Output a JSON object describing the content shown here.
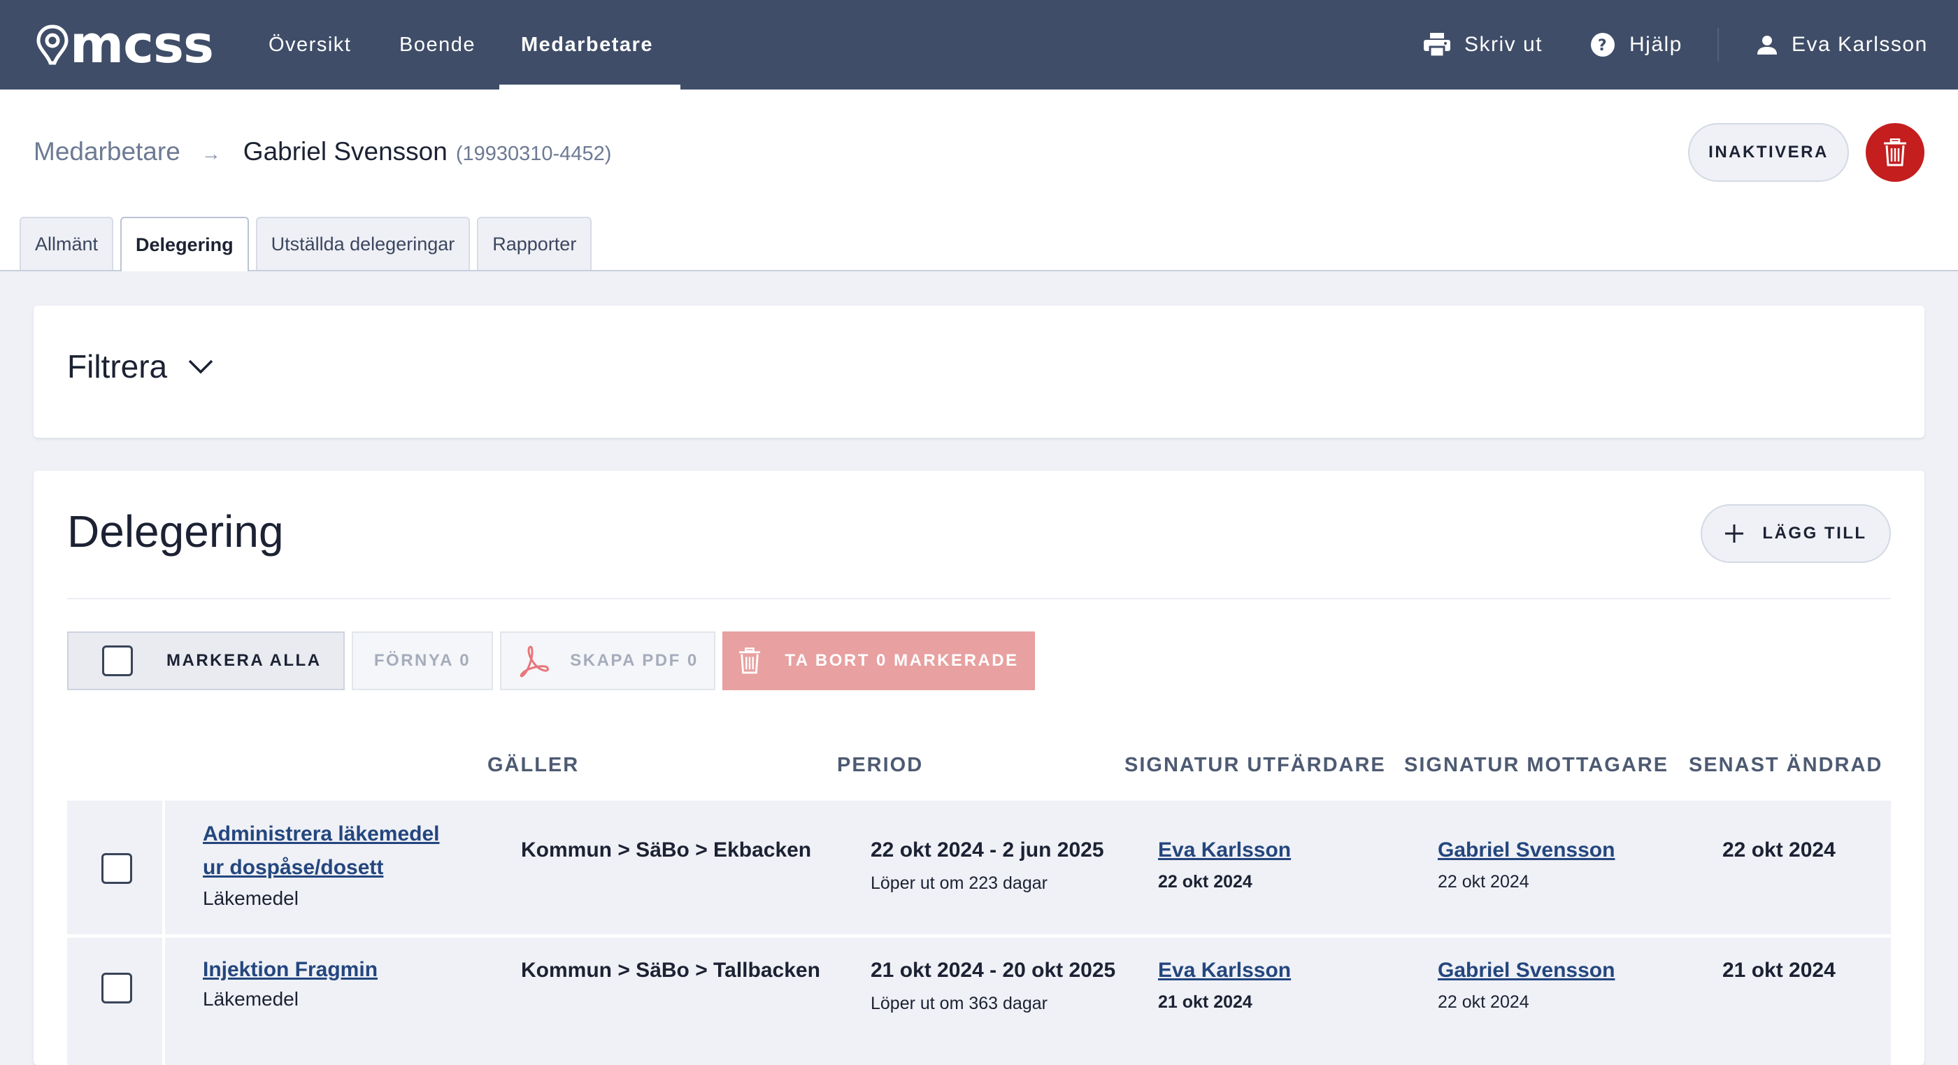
{
  "app": {
    "logo_text": "mcss",
    "nav": [
      {
        "label": "Översikt"
      },
      {
        "label": "Boende"
      },
      {
        "label": "Medarbetare",
        "active": true
      }
    ],
    "print_label": "Skriv ut",
    "help_label": "Hjälp",
    "user_name": "Eva Karlsson"
  },
  "breadcrumb": {
    "parent": "Medarbetare",
    "current": "Gabriel Svensson",
    "id": "(19930310-4452)"
  },
  "header": {
    "inaktivera_label": "INAKTIVERA"
  },
  "tabs": [
    {
      "label": "Allmänt"
    },
    {
      "label": "Delegering",
      "active": true
    },
    {
      "label": "Utställda delegeringar"
    },
    {
      "label": "Rapporter"
    }
  ],
  "filter": {
    "title": "Filtrera"
  },
  "delegering": {
    "title": "Delegering",
    "add_label": "LÄGG TILL",
    "actions": {
      "markera_alla": "MARKERA ALLA",
      "fornya": "FÖRNYA 0",
      "skapa_pdf": "SKAPA PDF 0",
      "ta_bort": "TA BORT 0 MARKERADE"
    },
    "columns": [
      "GÄLLER",
      "PERIOD",
      "SIGNATUR UTFÄRDARE",
      "SIGNATUR MOTTAGARE",
      "SENAST ÄNDRAD"
    ],
    "rows": [
      {
        "title_line1": "Administrera läkemedel",
        "title_line2": "ur dospåse/dosett",
        "category": "Läkemedel",
        "galler": "Kommun > SäBo > Ekbacken",
        "period": "22 okt 2024 - 2 jun 2025",
        "period_note": "Löper ut om 223 dagar",
        "utfardare": "Eva Karlsson",
        "utfardare_date": "22 okt 2024",
        "mottagare": "Gabriel Svensson",
        "mottagare_date": "22 okt 2024",
        "senast_andrad": "22 okt 2024"
      },
      {
        "title_line1": "Injektion Fragmin",
        "category": "Läkemedel",
        "galler": "Kommun > SäBo > Tallbacken",
        "period": "21 okt 2024 - 20 okt 2025",
        "period_note": "Löper ut om 363 dagar",
        "utfardare": "Eva Karlsson",
        "utfardare_date": "21 okt 2024",
        "mottagare": "Gabriel Svensson",
        "mottagare_date": "22 okt 2024",
        "senast_andrad": "21 okt 2024"
      }
    ]
  },
  "colors": {
    "nav_bg": "#3f4d68",
    "danger": "#c41e1e",
    "danger_soft": "#e8a0a0",
    "link": "#24467e",
    "page_bg": "#eff1f6"
  }
}
